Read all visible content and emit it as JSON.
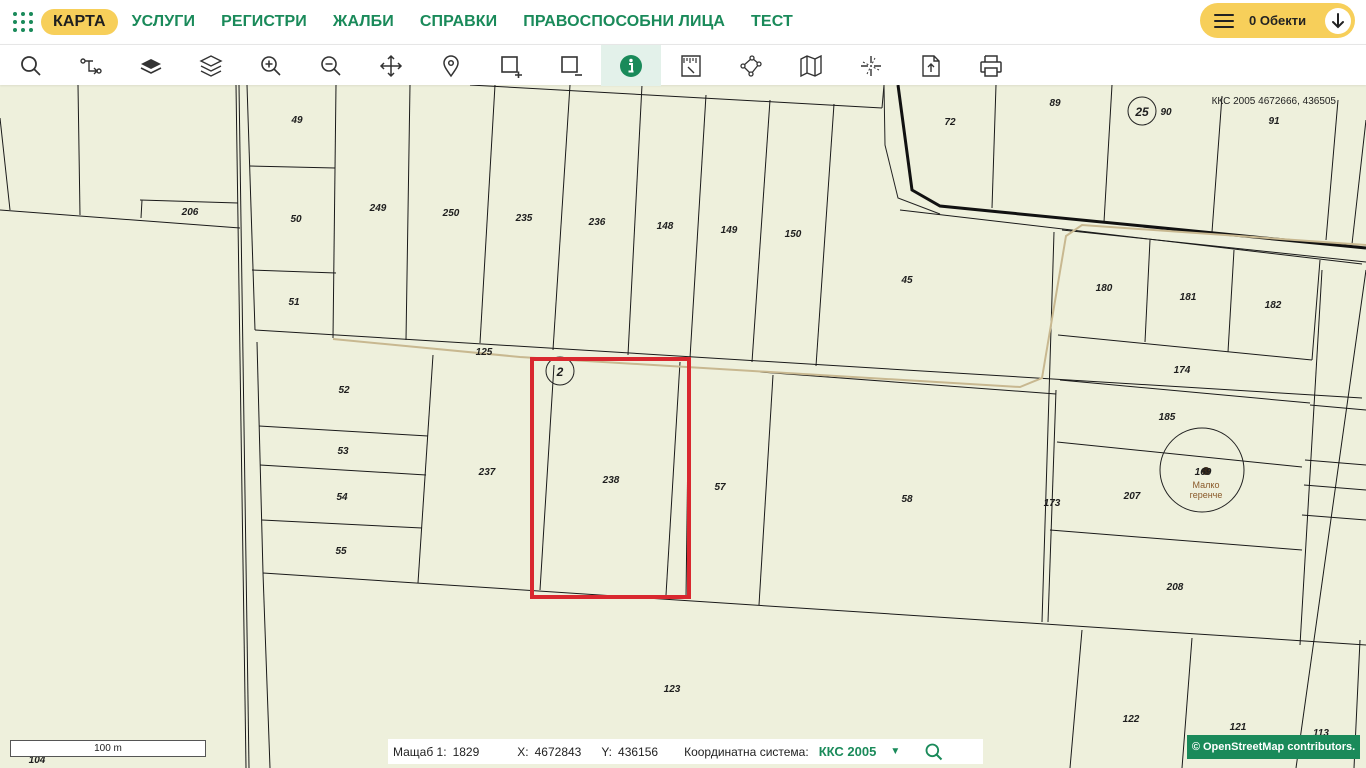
{
  "nav": {
    "items": [
      "КАРТА",
      "УСЛУГИ",
      "РЕГИСТРИ",
      "ЖАЛБИ",
      "СПРАВКИ",
      "ПРАВОСПОСОБНИ ЛИЦА",
      "ТЕСТ"
    ],
    "active": "КАРТА",
    "objects_label": "0 Обекти"
  },
  "toolbar": {
    "tools": [
      "search-icon",
      "route-icon",
      "layer-single-icon",
      "layers-icon",
      "zoom-in-icon",
      "zoom-out-icon",
      "pan-icon",
      "location-pin-icon",
      "select-add-icon",
      "select-remove-icon",
      "info-icon",
      "measure-icon",
      "polygon-icon",
      "map-icon",
      "crosshair-icon",
      "export-icon",
      "print-icon"
    ],
    "active": "info-icon"
  },
  "map": {
    "coordinate_readout": "ККС 2005 4672666, 436505",
    "place_name_line1": "Малко",
    "place_name_line2": "геренче",
    "parcel_labels": [
      "49",
      "50",
      "51",
      "206",
      "249",
      "250",
      "235",
      "236",
      "148",
      "149",
      "150",
      "45",
      "72",
      "89",
      "90",
      "91",
      "25",
      "180",
      "181",
      "182",
      "174",
      "185",
      "207",
      "208",
      "173",
      "52",
      "53",
      "54",
      "55",
      "125",
      "2",
      "237",
      "238",
      "57",
      "58",
      "123",
      "122",
      "121",
      "113",
      "104",
      "169"
    ],
    "scale_bar": "100 m",
    "attribution": "© OpenStreetMap contributors."
  },
  "status": {
    "scale_label": "Мащаб 1:",
    "scale_value": "1829",
    "x_label": "X:",
    "x_value": "4672843",
    "y_label": "Y:",
    "y_value": "436156",
    "crs_label": "Координатна система:",
    "crs_value": "ККС 2005"
  },
  "colors": {
    "brand_green": "#1a8a5a",
    "active_yellow": "#f7cf5a",
    "map_background": "#eef0dc",
    "selection_red": "#d9282f",
    "road_tan": "#c8b890"
  }
}
